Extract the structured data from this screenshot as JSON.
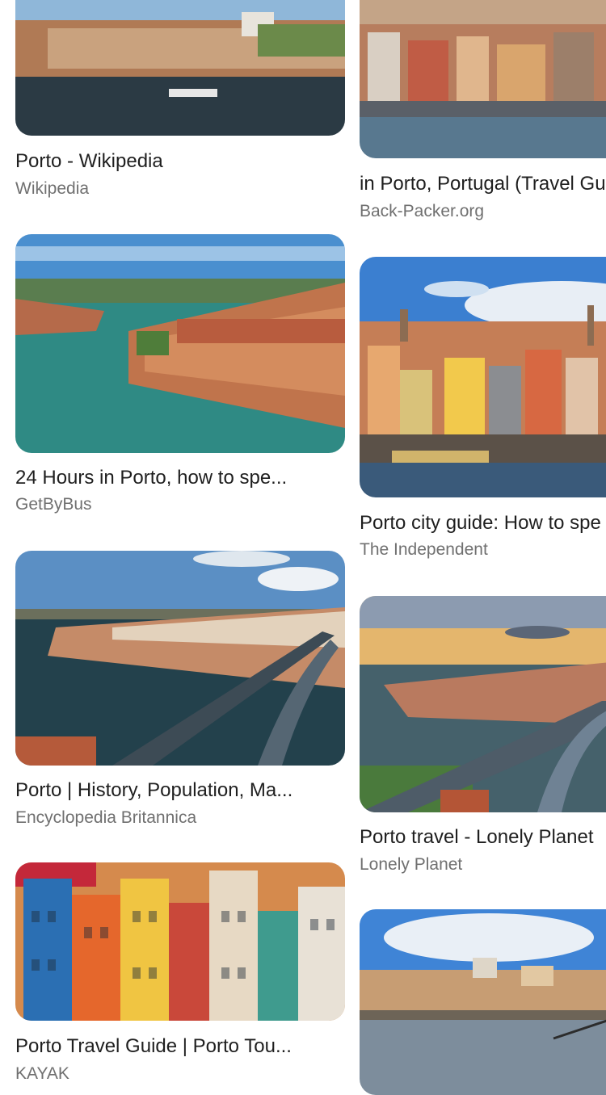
{
  "results": [
    {
      "title": "Porto - Wikipedia",
      "source": "Wikipedia"
    },
    {
      "title": "in Porto, Portugal (Travel Gu",
      "source": "Back-Packer.org"
    },
    {
      "title": "24 Hours in Porto, how to spe...",
      "source": "GetByBus"
    },
    {
      "title": "Porto city guide: How to spe",
      "source": "The Independent"
    },
    {
      "title": "Porto | History, Population, Ma...",
      "source": "Encyclopedia Britannica"
    },
    {
      "title": "Porto travel - Lonely Planet",
      "source": "Lonely Planet"
    },
    {
      "title": "Porto Travel Guide | Porto Tou...",
      "source": "KAYAK"
    },
    {
      "title": "",
      "source": ""
    }
  ]
}
